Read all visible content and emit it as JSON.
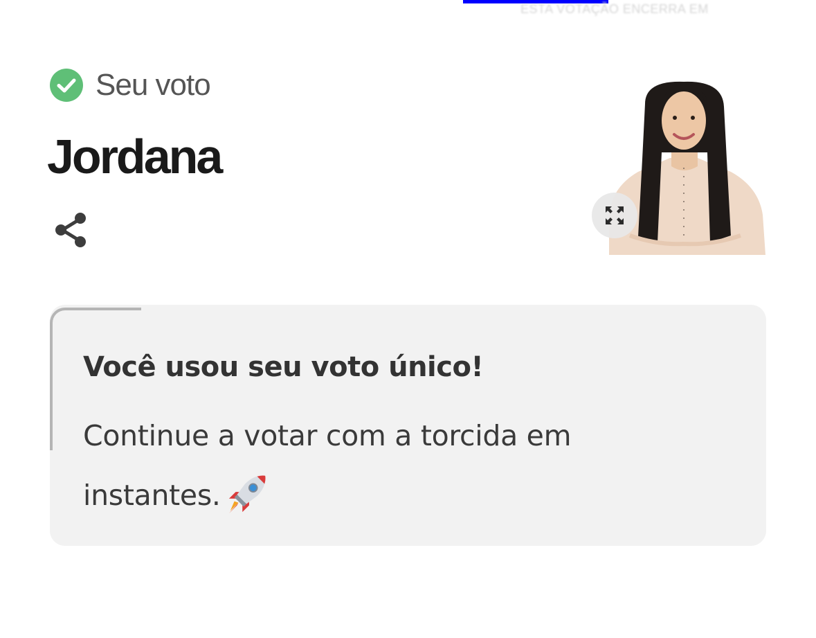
{
  "header": {
    "faded_text": "ESTA VOTAÇÃO ENCERRA EM"
  },
  "vote_status": {
    "label": "Seu voto",
    "icon": "check-circle-icon",
    "icon_color": "#5fbf77"
  },
  "candidate": {
    "name": "Jordana",
    "photo": "candidate-photo"
  },
  "actions": {
    "share_icon": "share-icon",
    "expand_icon": "expand-icon"
  },
  "info_card": {
    "title": "Você usou seu voto único!",
    "body": "Continue a votar com a torcida em instantes.",
    "emoji": "rocket-icon"
  },
  "colors": {
    "accent_blue": "#0000ff",
    "card_background": "#f2f2f2",
    "check_green": "#5fbf77"
  }
}
